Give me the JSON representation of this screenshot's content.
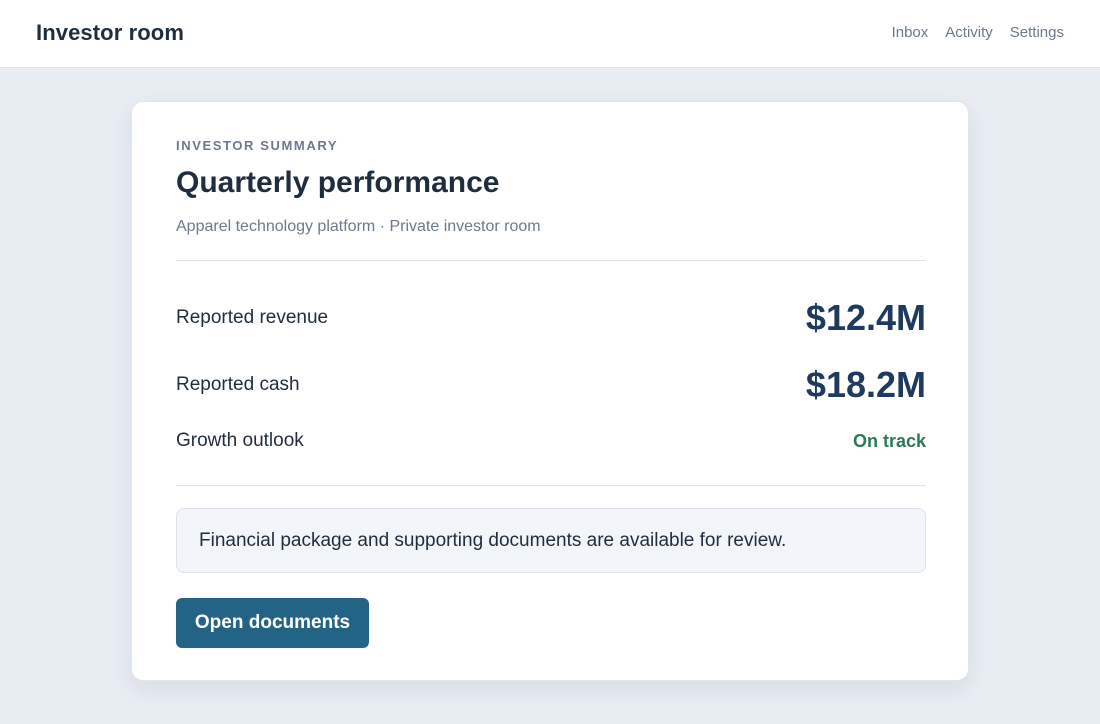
{
  "header": {
    "title": "Investor room",
    "nav": [
      "Inbox",
      "Activity",
      "Settings"
    ]
  },
  "card": {
    "eyebrow": "INVESTOR SUMMARY",
    "title": "Quarterly performance",
    "subtitle": "Apparel technology platform · Private investor room",
    "metrics": [
      {
        "label": "Reported revenue",
        "value": "$12.4M"
      },
      {
        "label": "Reported cash",
        "value": "$18.2M"
      },
      {
        "label": "Growth outlook",
        "value": "On track"
      }
    ],
    "notice": "Financial package and supporting documents are available for review.",
    "button_label": "Open documents"
  },
  "colors": {
    "accent": "#236486",
    "status_positive": "#2a7a58",
    "metric_value": "#1e3a5f",
    "background": "#e8ecf3"
  }
}
